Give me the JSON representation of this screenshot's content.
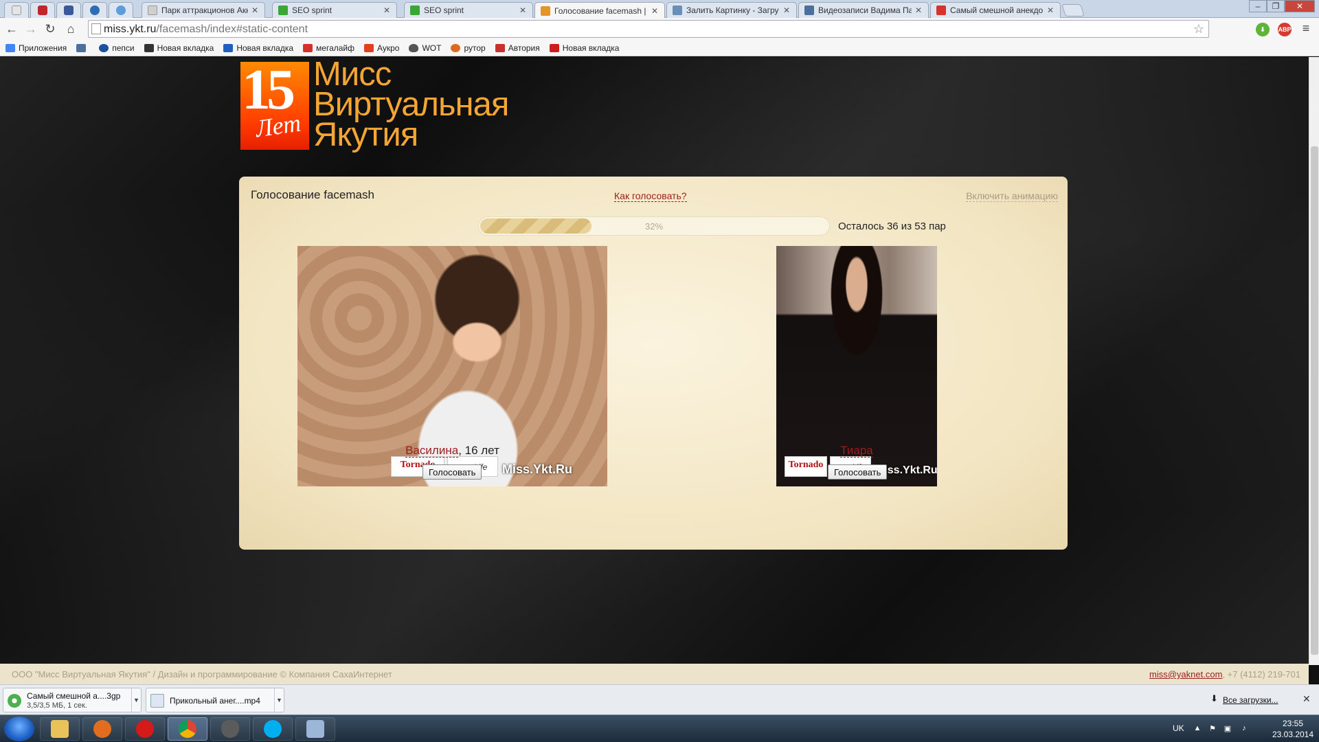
{
  "tabs": [
    {
      "title": "Парк аттракционов Акко",
      "active": false,
      "icon_color": "#9c9c9c"
    },
    {
      "title": "SEO sprint",
      "active": false,
      "icon_color": "#3aa636"
    },
    {
      "title": "SEO sprint",
      "active": false,
      "icon_color": "#3aa636"
    },
    {
      "title": "Голосование facemash | М",
      "active": true,
      "icon_color": "#e4952a"
    },
    {
      "title": "Залить Картинку - Загру",
      "active": false,
      "icon_color": "#6a8fb6"
    },
    {
      "title": "Видеозаписи Вадима Па",
      "active": false,
      "icon_color": "#4d6f9b"
    },
    {
      "title": "Самый смешной анекдо",
      "active": false,
      "icon_color": "#d8322d"
    }
  ],
  "address_bar": {
    "host": "miss.ykt.ru",
    "path": "/facemash/index#static-content"
  },
  "bookmarks": [
    {
      "label": "Приложения",
      "color": "#4285f4"
    },
    {
      "label": "",
      "color": "#4d6f9b"
    },
    {
      "label": "пепси",
      "color": "#1b4fa0"
    },
    {
      "label": "Новая вкладка",
      "color": "#333333"
    },
    {
      "label": "Новая вкладка",
      "color": "#1f5fbf"
    },
    {
      "label": "мегалайф",
      "color": "#d7302a"
    },
    {
      "label": "Аукро",
      "color": "#e04020"
    },
    {
      "label": "WOT",
      "color": "#555555"
    },
    {
      "label": "рутор",
      "color": "#e06a1c"
    },
    {
      "label": "Автория",
      "color": "#c8322e"
    },
    {
      "label": "Новая вкладка",
      "color": "#cc1c1c"
    }
  ],
  "logo": {
    "badge_number": "15",
    "badge_word": "Лет",
    "line1": "Мисс",
    "line2": "Виртуальная",
    "line3": "Якутия"
  },
  "voting": {
    "title": "Голосование facemash",
    "how_to_link": "Как голосовать?",
    "animation_link": "Включить анимацию",
    "progress_fraction": 0.32,
    "progress_label": "32%",
    "remaining_text": "Осталось 36 из 53 пар",
    "left": {
      "name": "Василина",
      "age_text": ", 16 лет",
      "vote_label": "Голосовать",
      "watermark_brand": "Tornado",
      "watermark_partner": "autoLife",
      "watermark_site": "Miss.Ykt.Ru"
    },
    "right": {
      "name": "Тиара",
      "age_text": "",
      "vote_label": "Голосовать",
      "watermark_brand": "Tornado",
      "watermark_partner": "autoLife",
      "watermark_site": "Miss.Ykt.Ru"
    }
  },
  "footer": {
    "left_text": "ООО \"Мисс Виртуальная Якутия\" / Дизайн и программирование © Компания СахаИнтернет",
    "email": "miss@yaknet.com",
    "phone": ", +7 (4112) 219-701"
  },
  "downloads": [
    {
      "name": "Самый смешной а....3gp",
      "info": "3,5/3,5 МБ, 1 сек."
    },
    {
      "name": "Прикольный анег....mp4",
      "info": ""
    }
  ],
  "downloads_all_label": "Все загрузки...",
  "tray": {
    "lang": "UK",
    "time": "23:55",
    "date": "23.03.2014"
  }
}
